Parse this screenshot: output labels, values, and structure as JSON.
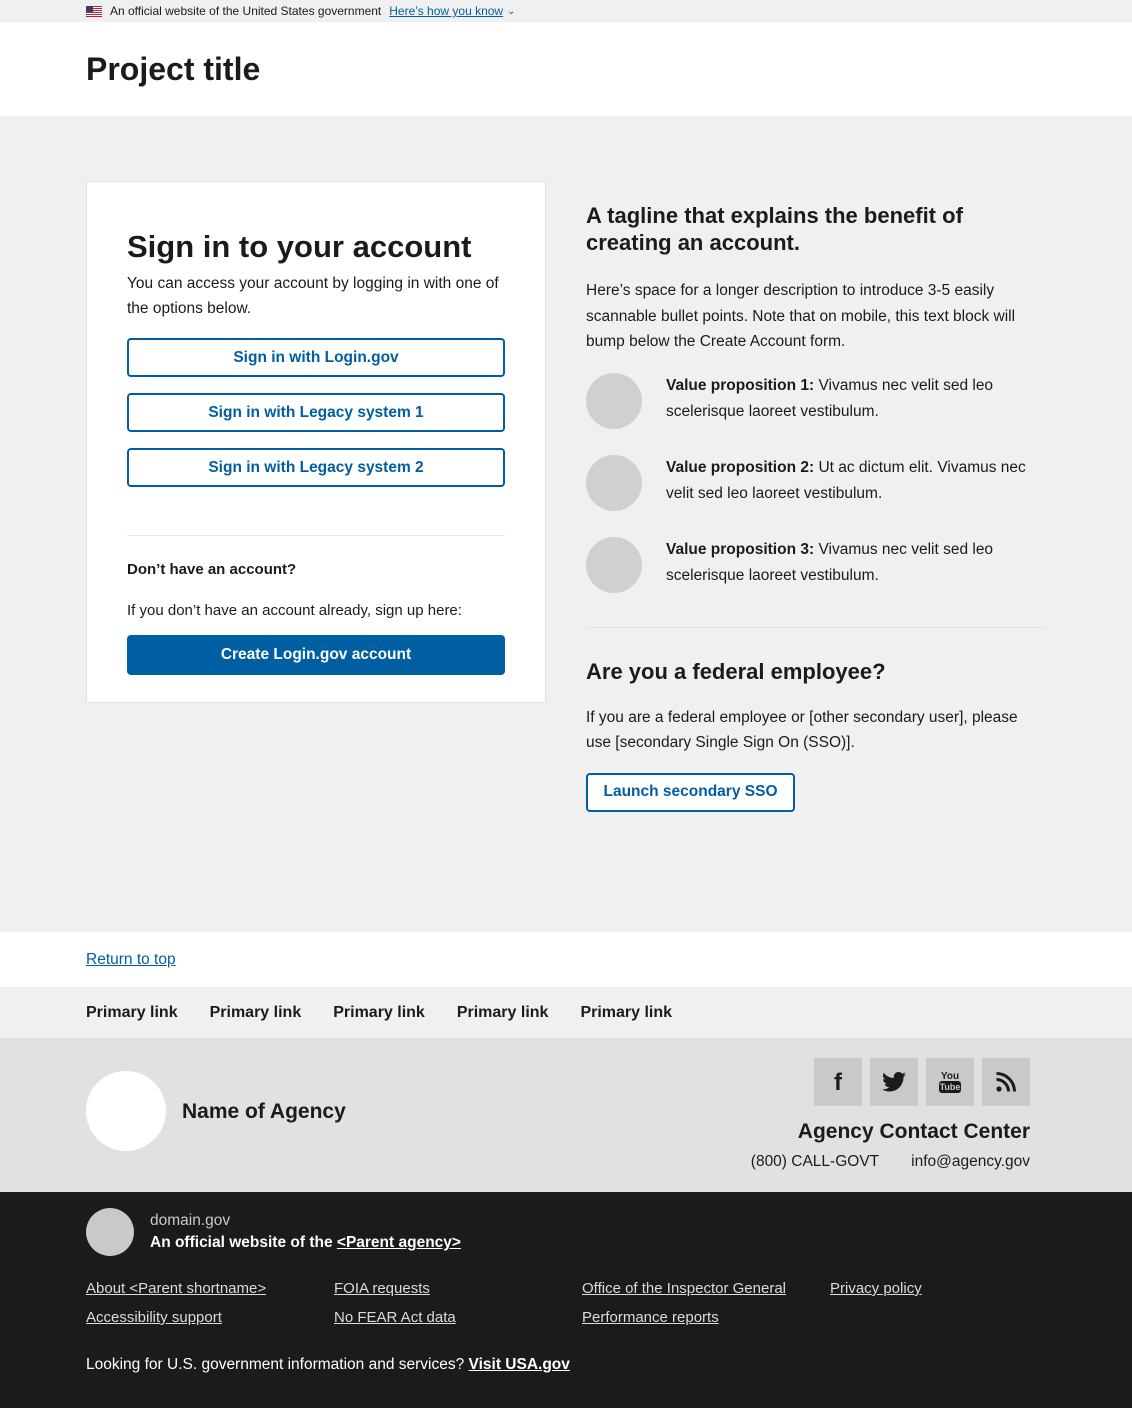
{
  "banner": {
    "text": "An official website of the United States government",
    "link": "Here’s how you know"
  },
  "header": {
    "title": "Project title"
  },
  "signin": {
    "title": "Sign in to your account",
    "intro": "You can access your account by logging in with one of the options below.",
    "buttons": [
      "Sign in with Login.gov",
      "Sign in with Legacy system 1",
      "Sign in with Legacy system 2"
    ],
    "no_account_heading": "Don’t have an account?",
    "no_account_text": "If you don’t have an account already, sign up here:",
    "create_button": "Create Login.gov account"
  },
  "side": {
    "tagline": "A tagline that explains the benefit of creating an account.",
    "description": "Here’s space for a longer description to introduce 3-5 easily scannable bullet points. Note that on mobile, this text block will bump below the Create Account form.",
    "value_props": [
      {
        "label": "Value proposition 1:",
        "text": " Vivamus nec velit sed leo scelerisque laoreet vestibulum."
      },
      {
        "label": "Value proposition 2:",
        "text": " Ut ac dictum elit. Vivamus nec velit sed leo laoreet vestibulum."
      },
      {
        "label": "Value proposition 3:",
        "text": " Vivamus nec velit sed leo scelerisque laoreet vestibulum."
      }
    ],
    "federal_heading": "Are you a federal employee?",
    "federal_text": "If you are a federal employee or [other secondary user], please use [secondary Single Sign On (SSO)].",
    "sso_button": "Launch secondary SSO"
  },
  "footer": {
    "return_to_top": "Return to top",
    "primary_links": [
      "Primary link",
      "Primary link",
      "Primary link",
      "Primary link",
      "Primary link"
    ],
    "agency_name": "Name of Agency",
    "social_icons": [
      "facebook-icon",
      "twitter-icon",
      "youtube-icon",
      "rss-icon"
    ],
    "contact_heading": "Agency Contact Center",
    "phone": "(800) CALL-GOVT",
    "email": "info@agency.gov"
  },
  "identifier": {
    "domain": "domain.gov",
    "official_prefix": "An official website of the ",
    "parent_agency": "<Parent agency>",
    "links": [
      "About <Parent shortname>",
      "FOIA requests",
      "Office of the Inspector General",
      "Privacy policy",
      "Accessibility support",
      "No FEAR Act data",
      "Performance reports"
    ],
    "usa_text": "Looking for U.S. government information and services? ",
    "usa_link": "Visit USA.gov"
  },
  "colors": {
    "primary": "#005ea2",
    "dark": "#1b1b1b",
    "light_bg": "#f0f0f0",
    "footer_bg": "#dfe1e2"
  }
}
